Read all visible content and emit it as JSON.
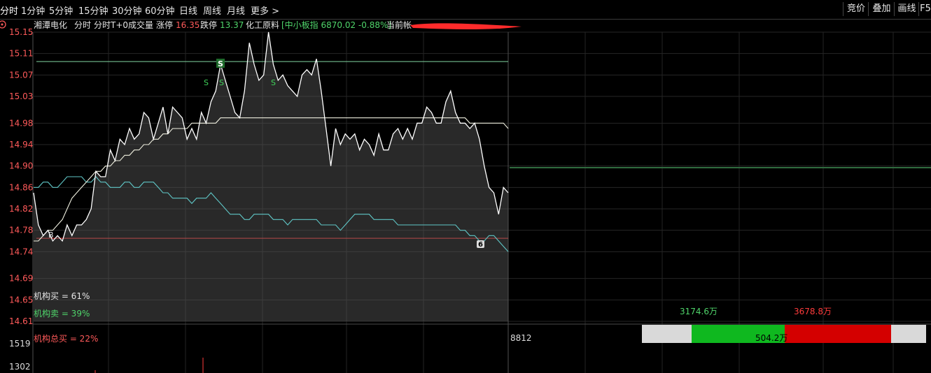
{
  "toolbar": {
    "timeframes": [
      "分时",
      "1分钟",
      "5分钟",
      "15分钟",
      "30分钟",
      "60分钟",
      "日线",
      "周线",
      "月线",
      "更多 >"
    ],
    "right_buttons": [
      "竞价",
      "叠加",
      "画线",
      "F5"
    ]
  },
  "info_bar": {
    "stock_name": "湘潭电化",
    "mode1": "分时",
    "mode2": "分时T+0",
    "volume_label": "成交量",
    "limit_up_label": "涨停",
    "limit_up_value": "16.35",
    "limit_down_label": "跌停",
    "limit_down_value": "13.37",
    "sector": "化工原料",
    "index_text": "[中小板指 6870.02 -0.88%]",
    "current_label": "当前帐"
  },
  "markers": {
    "sell": "S",
    "buy": "B",
    "circle": "6"
  },
  "inst_labels": {
    "buy": "机构买 = 61%",
    "sell": "机构卖 = 39%",
    "total_buy": "机构总买 = 22%"
  },
  "bidask": {
    "green_amount": "3174.6万",
    "red_amount": "3678.8万",
    "diff_amount": "504.2万",
    "vol_readout": "8812"
  },
  "colors": {
    "price_line": "#ffffff",
    "avg_line": "#f0f0e0",
    "cyan_line": "#5fc6c6",
    "green_level": "#7fd4a0",
    "red_level": "#ff3b3b"
  },
  "chart_data": {
    "type": "line",
    "yticks": [
      "15.15",
      "15.11",
      "15.07",
      "15.03",
      "14.98",
      "14.94",
      "14.90",
      "14.86",
      "14.82",
      "14.78",
      "14.74",
      "14.69",
      "14.65",
      "14.61"
    ],
    "vol_ticks": [
      "1519",
      "1302"
    ],
    "ylim": [
      14.61,
      15.15
    ],
    "x_slots": 100,
    "green_level": 15.095,
    "red_level": 14.765,
    "series": [
      {
        "values": [
          14.85,
          14.79,
          14.77,
          14.78,
          14.76,
          14.77,
          14.76,
          14.79,
          14.77,
          14.79,
          14.79,
          14.8,
          14.82,
          14.89,
          14.88,
          14.88,
          14.93,
          14.91,
          14.95,
          14.94,
          14.97,
          14.95,
          14.96,
          15.0,
          14.99,
          14.95,
          14.98,
          15.01,
          14.96,
          15.01,
          15.0,
          14.99,
          14.95,
          14.97,
          14.95,
          15.0,
          14.98,
          15.02,
          15.04,
          15.09,
          15.06,
          15.03,
          15.0,
          14.99,
          15.04,
          15.13,
          15.09,
          15.06,
          15.07,
          15.15,
          15.09,
          15.06,
          15.07,
          15.05,
          15.04,
          15.03,
          15.07,
          15.08,
          15.07,
          15.1,
          15.04,
          14.97,
          14.9,
          14.97,
          14.94,
          14.96,
          14.95,
          14.96,
          14.93,
          14.95,
          14.94,
          14.92,
          14.96,
          14.93,
          14.93,
          14.96,
          14.97,
          14.95,
          14.97,
          14.95,
          14.98,
          14.98,
          15.01,
          15.0,
          14.98,
          14.98,
          15.02,
          15.04,
          15.0,
          14.98,
          14.98,
          14.97,
          14.98,
          14.95,
          14.9,
          14.86,
          14.85,
          14.81,
          14.86,
          14.85
        ],
        "note": "price"
      },
      {
        "values": [
          14.76,
          14.76,
          14.77,
          14.78,
          14.78,
          14.79,
          14.8,
          14.82,
          14.84,
          14.85,
          14.86,
          14.87,
          14.88,
          14.89,
          14.89,
          14.9,
          14.9,
          14.91,
          14.91,
          14.92,
          14.92,
          14.93,
          14.93,
          14.94,
          14.94,
          14.95,
          14.95,
          14.96,
          14.96,
          14.97,
          14.97,
          14.97,
          14.97,
          14.98,
          14.98,
          14.98,
          14.98,
          14.98,
          14.98,
          14.99,
          14.99,
          14.99,
          14.99,
          14.99,
          14.99,
          14.99,
          14.99,
          14.99,
          14.99,
          14.99,
          14.99,
          14.99,
          14.99,
          14.99,
          14.99,
          14.99,
          14.99,
          14.99,
          14.99,
          14.99,
          14.99,
          14.99,
          14.99,
          14.99,
          14.99,
          14.99,
          14.99,
          14.99,
          14.99,
          14.99,
          14.99,
          14.99,
          14.99,
          14.99,
          14.99,
          14.99,
          14.99,
          14.99,
          14.99,
          14.99,
          14.99,
          14.99,
          14.99,
          14.99,
          14.99,
          14.99,
          14.99,
          14.99,
          14.99,
          14.99,
          14.99,
          14.98,
          14.98,
          14.98,
          14.98,
          14.98,
          14.98,
          14.98,
          14.98,
          14.97
        ],
        "note": "average"
      }
    ]
  }
}
